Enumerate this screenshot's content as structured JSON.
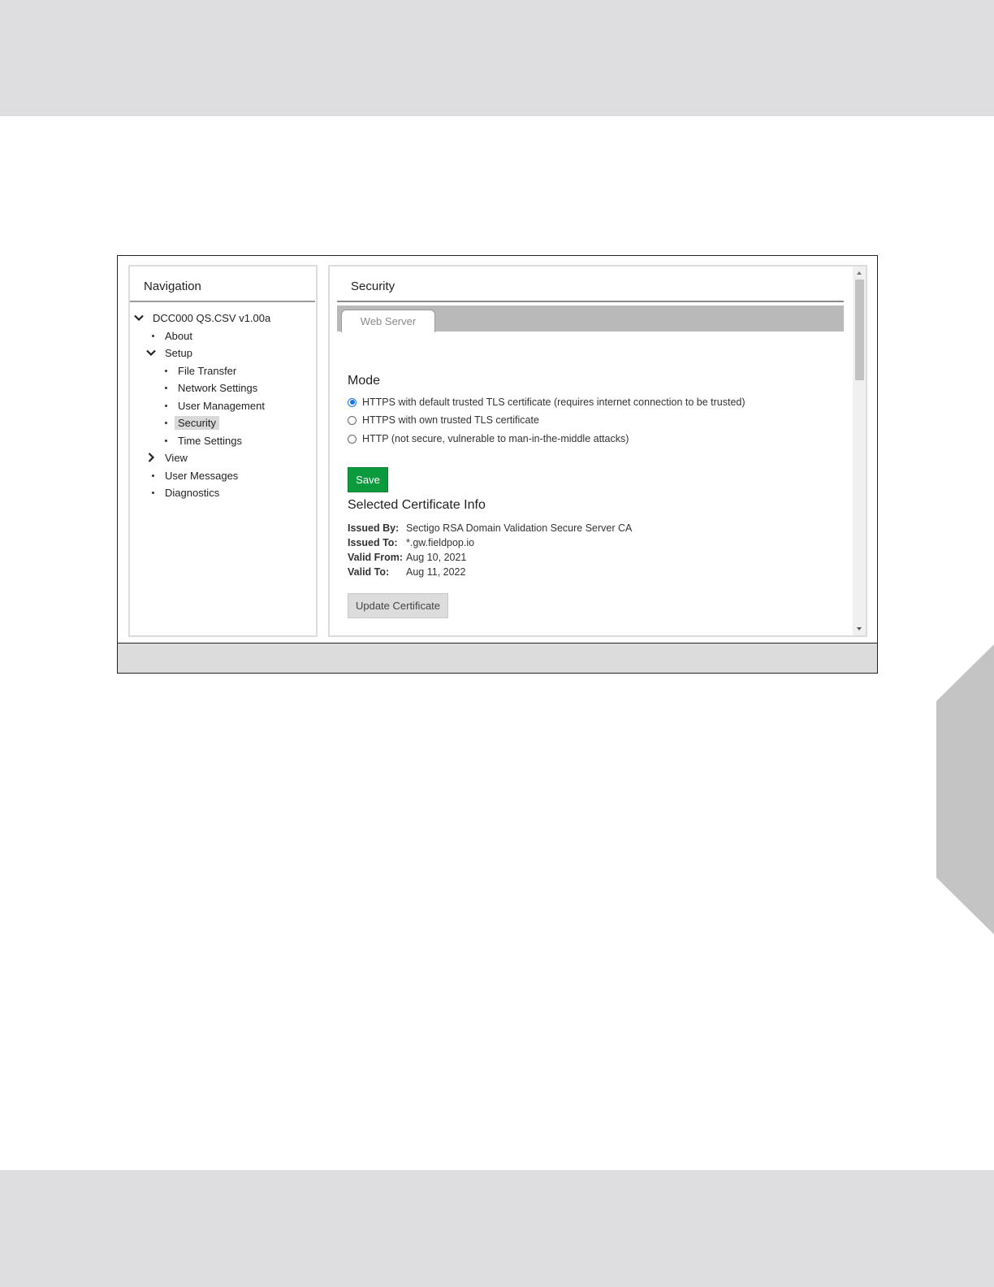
{
  "navigation": {
    "title": "Navigation",
    "items": [
      {
        "label": "DCC000 QS.CSV v1.00a",
        "type": "expanded"
      },
      {
        "label": "About",
        "type": "bullet"
      },
      {
        "label": "Setup",
        "type": "expanded"
      },
      {
        "label": "File Transfer",
        "type": "bullet"
      },
      {
        "label": "Network Settings",
        "type": "bullet"
      },
      {
        "label": "User Management",
        "type": "bullet"
      },
      {
        "label": "Security",
        "type": "bullet",
        "selected": true
      },
      {
        "label": "Time Settings",
        "type": "bullet"
      },
      {
        "label": "View",
        "type": "collapsed"
      },
      {
        "label": "User Messages",
        "type": "bullet"
      },
      {
        "label": "Diagnostics",
        "type": "bullet"
      }
    ]
  },
  "content": {
    "title": "Security",
    "tabs": [
      {
        "label": "Web Server",
        "active": true
      }
    ],
    "mode": {
      "heading": "Mode",
      "options": [
        {
          "label": "HTTPS with default trusted TLS certificate (requires internet connection to be trusted)",
          "checked": true
        },
        {
          "label": "HTTPS with own trusted TLS certificate",
          "checked": false
        },
        {
          "label": "HTTP (not secure, vulnerable to man-in-the-middle attacks)",
          "checked": false
        }
      ]
    },
    "save_label": "Save",
    "certificate": {
      "heading": "Selected Certificate Info",
      "issued_by_label": "Issued By:",
      "issued_by": "Sectigo RSA Domain Validation Secure Server CA",
      "issued_to_label": "Issued To:",
      "issued_to": "*.gw.fieldpop.io",
      "valid_from_label": "Valid From:",
      "valid_from": "Aug 10, 2021",
      "valid_to_label": "Valid To:",
      "valid_to": "Aug 11, 2022"
    },
    "update_certificate_label": "Update Certificate"
  },
  "colors": {
    "save_button": "#0b9a3d",
    "page_band": "#dedddf",
    "tab_bar": "#b9b9b9",
    "selected_nav": "#d9d9d9",
    "radio_checked": "#1a73e8"
  },
  "icons": {
    "expanded": "chevron-down-icon",
    "collapsed": "chevron-right-icon",
    "scroll_up": "triangle-up-icon",
    "scroll_down": "triangle-down-icon"
  }
}
